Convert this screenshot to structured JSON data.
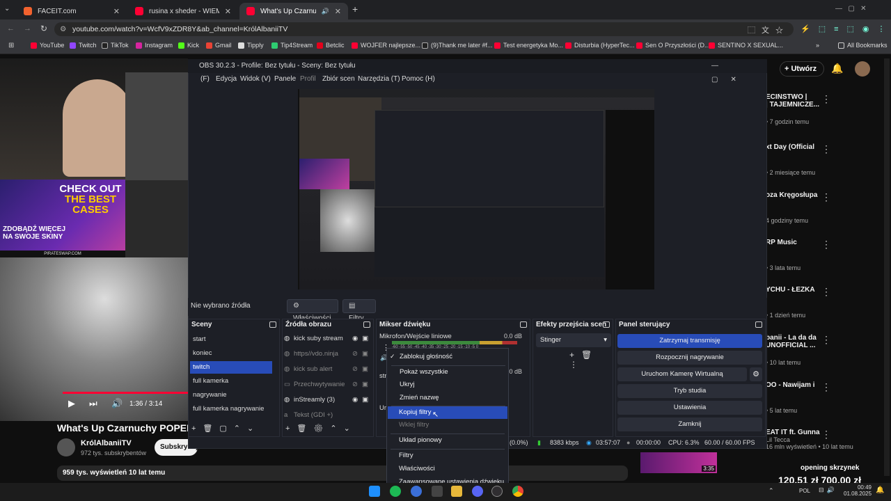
{
  "browser": {
    "tabs": [
      {
        "label": "FACEIT.com",
        "color": "#f2622e"
      },
      {
        "label": "rusina x sheder - WIEM DOBRZ",
        "color": "#ff0033"
      },
      {
        "label": "What's Up Czarnuchy POPE",
        "color": "#ff0033"
      }
    ],
    "url": "youtube.com/watch?v=WcfV9xZDR8Y&ab_channel=KrólAlbaniiTV",
    "bookmarks": [
      "YouTube",
      "Twitch",
      "TikTok",
      "Instagram",
      "Kick",
      "Gmail",
      "Tipply",
      "Tip4Stream",
      "Betclic",
      "WOJFER najlepsze...",
      "(9)Thank me later #f...",
      "Test energetyka Mo...",
      "Disturbia (HyperTec...",
      "Sen O Przyszłości (D...",
      "SENTINO X SEXUAL..."
    ],
    "all_bookmarks": "All Bookmarks"
  },
  "youtube": {
    "create_label": "Utwórz",
    "video_time": "1:36 / 3:14",
    "promo_line1": "CHECK OUT",
    "promo_line2": "THE BEST",
    "promo_line3": "CASES",
    "promo_line4": "ZDOBĄDŹ WIĘCEJ",
    "promo_line5": "NA SWOJE SKINY",
    "promo_site": "PIRATESWAP.COM",
    "title": "What's Up Czarnuchy POPEK &",
    "channel": "KrólAlbaniiTV",
    "subscribers": "972 tys. subskrybentów",
    "subscribe": "Subskrybuj",
    "views": "959 tys. wyświetleń  10 lat temu",
    "sidebar": [
      {
        "title": "ECIŃSTWO |",
        "title2": "| TAJEMNICZE...",
        "meta": "• 7 godzin temu"
      },
      {
        "title": "xt Day (Official",
        "meta": "• 2 miesiące temu"
      },
      {
        "title": "oza Kręgosłupa",
        "meta": "4 godziny temu"
      },
      {
        "title": "RP Music",
        "meta": "• 3 lata temu"
      },
      {
        "title": "YCHU - ŁEZKA",
        "meta": "• 1 dzień temu"
      },
      {
        "title": "banii - La da da",
        "title2": "UNOFFICIAL ...",
        "meta": "• 10 lat temu"
      },
      {
        "title": "OO - Nawijam i",
        "meta": "• 5 lat temu"
      },
      {
        "title": "EAT IT ft. Gunna",
        "meta": "Lil Tecca"
      }
    ],
    "bottom_card_meta": "16 mln wyświetleń • 10 lat temu",
    "bottom_duration": "3:35",
    "opening_label": "opening skrzynek",
    "price_text": "120,51 zł  700,00 zł"
  },
  "obs": {
    "title": "OBS 30.2.3 - Profile: Bez tytułu - Sceny: Bez tytułu",
    "menu": [
      "(F)",
      "Edycja",
      "Widok (V)",
      "Panele",
      "Profil",
      "Zbiór scen",
      "Narzędzia (T)",
      "Pomoc (H)"
    ],
    "no_source": "Nie wybrano źródła",
    "properties_btn": "Właściwości",
    "filters_btn": "Filtry",
    "scenes_header": "Sceny",
    "scenes": [
      "start",
      "koniec",
      "twitch",
      "full kamerka",
      "nagrywanie",
      "full kamerka nagrywanie"
    ],
    "sources_header": "Źródła obrazu",
    "sources": [
      "kick suby stream",
      "https//vdo.ninja",
      "kick sub alert",
      "Przechwytywanie",
      "inStreamly (3)",
      "Tekst (GDI +)"
    ],
    "mixer_header": "Mikser dźwięku",
    "mixer_channel": "Mikrofon/Wejście liniowe",
    "mixer_db": "0.0 dB",
    "mixer_db2": "0.0 dB",
    "mixer_scale": "-60 -55 -50 -45 -40 -35 -30 -25 -20 -15 -10 -5 0",
    "transitions_header": "Efekty przejścia scen",
    "transition_value": "Stinger",
    "controls_header": "Panel sterujący",
    "controls": [
      "Zatrzymaj transmisję",
      "Rozpocznij nagrywanie",
      "Uruchom Kamerę Wirtualną",
      "Tryb studia",
      "Ustawienia",
      "Zamknij"
    ],
    "status": {
      "dropped": "(0.0%)",
      "kbps": "8383 kbps",
      "stream_time": "03:57:07",
      "rec_time": "00:00:00",
      "cpu": "CPU: 6.3%",
      "fps": "60.00 / 60.00 FPS"
    }
  },
  "context_menu": {
    "items": [
      "Zablokuj głośność",
      "Pokaż wszystkie",
      "Ukryj",
      "Zmień nazwę",
      "Kopiuj filtry",
      "Wklej filtry",
      "Układ pionowy",
      "Filtry",
      "Właściwości",
      "Zaawansowane ustawienia dźwięku"
    ]
  },
  "taskbar": {
    "lang": "POL",
    "time": "00:49",
    "date": "01.08.2025"
  }
}
